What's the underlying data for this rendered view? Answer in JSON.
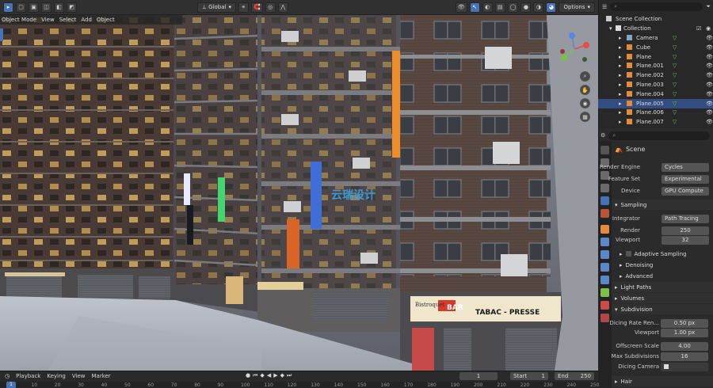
{
  "toolbar": {
    "mode_label": "Object Mode",
    "view_label": "View",
    "select_label": "Select",
    "add_label": "Add",
    "object_label": "Object",
    "transform_orientation": "Global",
    "options_label": "Options"
  },
  "outliner": {
    "title": "Scene Collection",
    "collection": "Collection",
    "items": [
      {
        "name": "Camera",
        "type": "camera"
      },
      {
        "name": "Cube",
        "type": "mesh"
      },
      {
        "name": "Plane",
        "type": "mesh"
      },
      {
        "name": "Plane.001",
        "type": "mesh"
      },
      {
        "name": "Plane.002",
        "type": "mesh"
      },
      {
        "name": "Plane.003",
        "type": "mesh"
      },
      {
        "name": "Plane.004",
        "type": "mesh"
      },
      {
        "name": "Plane.005",
        "type": "mesh",
        "selected": true
      },
      {
        "name": "Plane.006",
        "type": "mesh"
      },
      {
        "name": "Plane.007",
        "type": "mesh"
      }
    ]
  },
  "properties": {
    "context": "Scene",
    "render_engine_label": "Render Engine",
    "render_engine": "Cycles",
    "feature_set_label": "Feature Set",
    "feature_set": "Experimental",
    "device_label": "Device",
    "device": "GPU Compute",
    "sampling_label": "Sampling",
    "integrator_label": "Integrator",
    "integrator": "Path Tracing",
    "render_label": "Render",
    "render_samples": "250",
    "viewport_label": "Viewport",
    "viewport_samples": "32",
    "adaptive_sampling_label": "Adaptive Sampling",
    "denoising_label": "Denoising",
    "advanced_label": "Advanced",
    "light_paths_label": "Light Paths",
    "volumes_label": "Volumes",
    "subdivision_label": "Subdivision",
    "dicing_rate_render_label": "Dicing Rate Ren...",
    "dicing_rate_render": "0.50 px",
    "dicing_rate_viewport_label": "Viewport",
    "dicing_rate_viewport": "1.00 px",
    "offscreen_scale_label": "Offscreen Scale",
    "offscreen_scale": "4.00",
    "max_subdivisions_label": "Max Subdivisions",
    "max_subdivisions": "16",
    "dicing_camera_label": "Dicing Camera",
    "hair_label": "Hair"
  },
  "timeline": {
    "playback_label": "Playback",
    "keying_label": "Keying",
    "view_label": "View",
    "marker_label": "Marker",
    "current_frame": "1",
    "start_label": "Start",
    "start_frame": "1",
    "end_label": "End",
    "end_frame": "250",
    "ticks": [
      "0",
      "10",
      "20",
      "30",
      "40",
      "50",
      "60",
      "70",
      "80",
      "90",
      "100",
      "110",
      "120",
      "130",
      "140",
      "150",
      "160",
      "170",
      "180",
      "190",
      "200",
      "210",
      "220",
      "230",
      "240",
      "250"
    ]
  },
  "signs": {
    "shop1": "BAR",
    "shop2": "TABAC - PRESSE",
    "shop3": "Bistroquet",
    "watermark": "云瑞设计"
  },
  "colors": {
    "selection": "#334d80",
    "accent": "#4772b3",
    "mesh_icon": "#e38b3c",
    "camera_icon": "#7ea8c9"
  }
}
